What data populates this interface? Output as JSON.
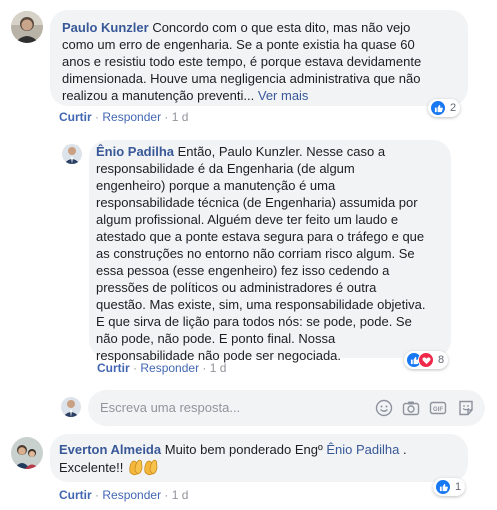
{
  "comments": [
    {
      "author": "Paulo Kunzler",
      "text": "Concordo com o que esta dito, mas não vejo",
      "lines": [
        "como um erro de engenharia. Se a ponte existia ha quase 60",
        "anos e resistiu todo este tempo, é porque estava devidamente",
        "dimensionada. Houve uma negligencia administrativa que não"
      ],
      "last_line": "realizou a manutenção preventi...",
      "see_more": "Ver mais",
      "actions": {
        "like": "Curtir",
        "reply": "Responder",
        "time": "1 d"
      },
      "reactions": {
        "count": "2"
      }
    },
    {
      "author": "Ênio Padilha",
      "text": "Então, Paulo Kunzler. Nesse caso a",
      "lines": [
        "responsabilidade é da Engenharia (de algum",
        "engenheiro) porque a manutenção é uma",
        "responsabilidade técnica (de Engenharia) assumida por",
        "algum profissional. Alguém deve ter feito um laudo e",
        "atestado que a ponte estava segura para o tráfego e que",
        "as construções no entorno não corriam risco algum. Se",
        "essa pessoa (esse engenheiro) fez isso cedendo a",
        "pressões de políticos ou administradores é outra",
        "questão. Mas existe, sim, uma responsabilidade objetiva.",
        "E que sirva de lição para todos nós: se pode, pode. Se",
        "não pode, não pode. E ponto final. Nossa",
        "responsabilidade não pode ser negociada."
      ],
      "actions": {
        "like": "Curtir",
        "reply": "Responder",
        "time": "1 d"
      },
      "reactions": {
        "count": "8"
      }
    },
    {
      "author": "Everton Almeida",
      "text": "Muito bem ponderado Engº",
      "mention": "Ênio Padilha",
      "text_after": ".",
      "line2": "Excelente!!",
      "actions": {
        "like": "Curtir",
        "reply": "Responder",
        "time": "1 d"
      },
      "reactions": {
        "count": "1"
      }
    }
  ],
  "reply_box": {
    "placeholder": "Escreva uma resposta...",
    "icons": [
      "emoji-icon",
      "camera-icon",
      "gif-icon",
      "sticker-icon"
    ]
  },
  "colors": {
    "link": "#385898",
    "action": "#4267b2",
    "bubble": "#f2f3f5",
    "muted": "#90949c"
  }
}
